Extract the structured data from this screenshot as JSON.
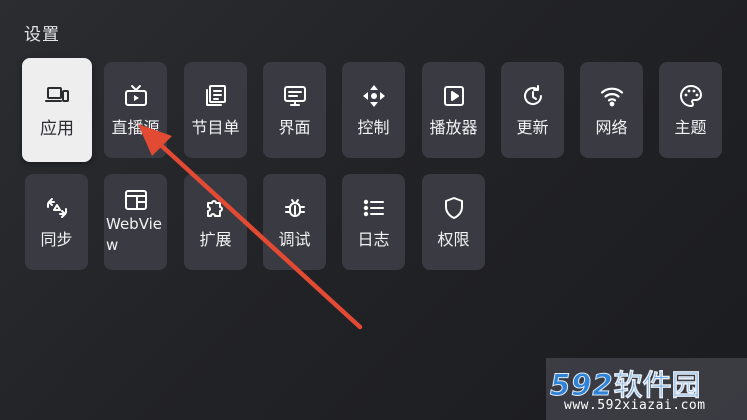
{
  "screen_title": "设置",
  "colors": {
    "tile_bg": "#3a3b42",
    "tile_selected_bg": "#eeeeef",
    "arrow": "#e34a33",
    "watermark_blue": "#2f83d6"
  },
  "tiles": [
    {
      "label": "应用",
      "icon": "devices-icon",
      "selected": true
    },
    {
      "label": "直播源",
      "icon": "tv-icon"
    },
    {
      "label": "节目单",
      "icon": "guide-list-icon"
    },
    {
      "label": "界面",
      "icon": "monitor-icon"
    },
    {
      "label": "控制",
      "icon": "dpad-icon"
    },
    {
      "label": "播放器",
      "icon": "play-box-icon"
    },
    {
      "label": "更新",
      "icon": "refresh-icon"
    },
    {
      "label": "网络",
      "icon": "wifi-icon"
    },
    {
      "label": "主题",
      "icon": "palette-icon"
    },
    {
      "label": "同步",
      "icon": "sync-icon"
    },
    {
      "label": "WebView",
      "icon": "browser-window-icon"
    },
    {
      "label": "扩展",
      "icon": "puzzle-icon"
    },
    {
      "label": "调试",
      "icon": "bug-icon"
    },
    {
      "label": "日志",
      "icon": "list-icon"
    },
    {
      "label": "权限",
      "icon": "shield-icon"
    }
  ],
  "watermark": {
    "brand_digits": "592",
    "brand_text": "软件园",
    "url": "www.592xiazai.com"
  }
}
